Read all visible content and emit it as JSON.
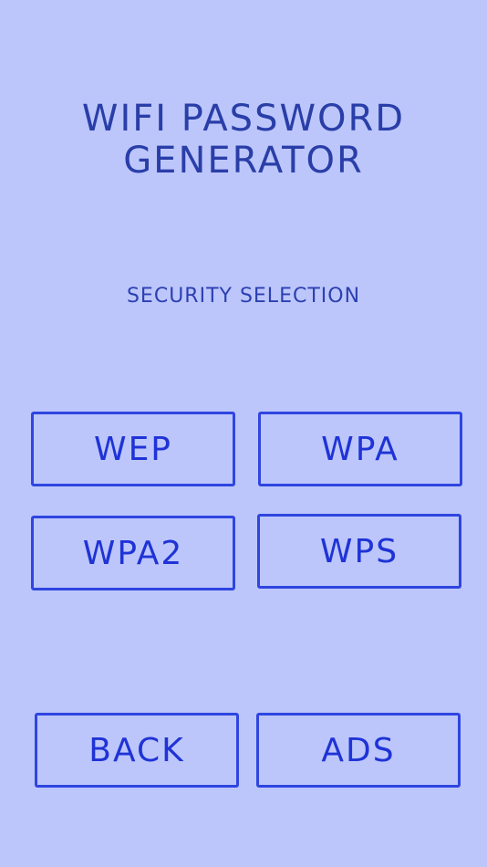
{
  "header": {
    "title_line1": "WIFI PASSWORD",
    "title_line2": "GENERATOR"
  },
  "section": {
    "label": "SECURITY SELECTION"
  },
  "security_options": {
    "wep": "WEP",
    "wpa": "WPA",
    "wpa2": "WPA2",
    "wps": "WPS"
  },
  "footer": {
    "back": "BACK",
    "ads": "ADS"
  },
  "colors": {
    "background": "#bcc6fb",
    "title": "#2a3ea8",
    "button_border": "#2f45e0",
    "button_text": "#1f33d6"
  }
}
